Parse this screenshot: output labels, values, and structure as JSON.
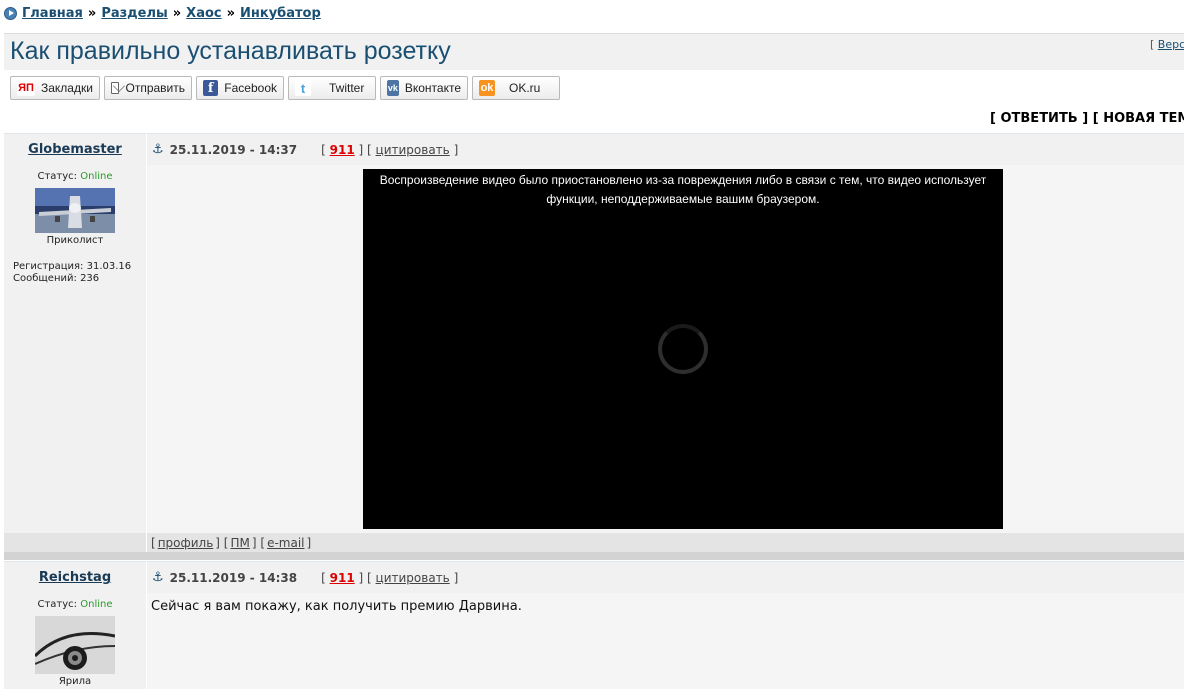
{
  "breadcrumb": {
    "items": [
      "Главная",
      "Разделы",
      "Хаос",
      "Инкубатор"
    ],
    "separator": "»"
  },
  "topic": {
    "title": "Как правильно устанавливать розетку",
    "version_prefix": "[",
    "version_link": "Верс"
  },
  "share": {
    "bookmarks": {
      "badge": "ЯП",
      "label": "Закладки"
    },
    "send": {
      "label": "Отправить"
    },
    "facebook": {
      "badge": "f",
      "label": "Facebook"
    },
    "twitter": {
      "badge": "t",
      "label": "Twitter"
    },
    "vk": {
      "badge": "vk",
      "label": "Вконтакте"
    },
    "ok": {
      "badge": "ok",
      "label": "OK.ru"
    }
  },
  "actions": {
    "open": "[",
    "reply": "ОТВЕТИТЬ",
    "mid": "] [",
    "new_topic": "НОВАЯ ТЕМА"
  },
  "labels": {
    "status": "Статус:",
    "registration": "Регистрация:",
    "messages": "Сообщений:",
    "bl": "[",
    "br": "]",
    "mid": "] ["
  },
  "posts": [
    {
      "author": "Globemaster",
      "status": "Online",
      "rank": "Приколист",
      "registered": "31.03.16",
      "messages": "236",
      "date": "25.11.2019 - 14:37",
      "number": "911",
      "quote": "цитировать",
      "video_message": "Воспроизведение видео было приостановлено из-за повреждения либо в связи с тем, что видео использует функции, неподдерживаемые вашим браузером.",
      "footer": {
        "profile": "профиль",
        "pm": "ПМ",
        "email": "e-mail"
      }
    },
    {
      "author": "Reichstag",
      "status": "Online",
      "rank": "Ярила",
      "date": "25.11.2019 - 14:38",
      "number": "911",
      "quote": "цитировать",
      "text": "Сейчас я вам покажу, как получить премию Дарвина."
    }
  ],
  "colors": {
    "link": "#1a4f72",
    "online": "#2a9a2a",
    "post_number": "#dd0000",
    "panel": "#f1f1f1"
  }
}
